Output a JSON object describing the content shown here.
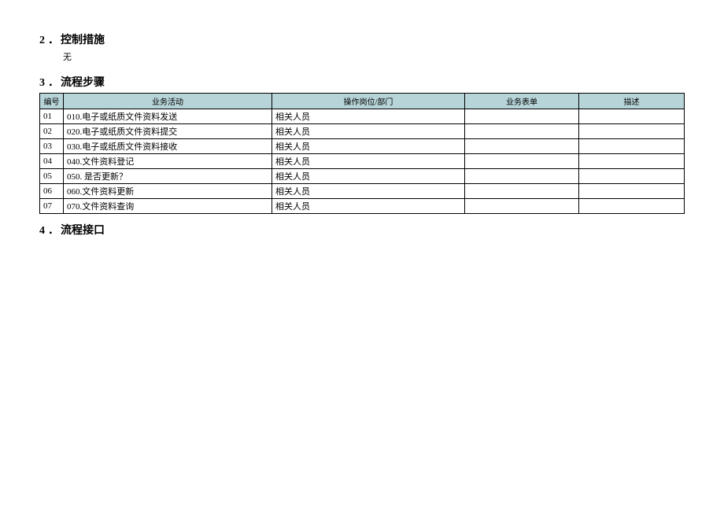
{
  "section2": {
    "number": "2",
    "dot": "．",
    "title": "控制措施",
    "content": "无"
  },
  "section3": {
    "number": "3",
    "dot": "．",
    "title": "流程步骤",
    "table": {
      "headers": {
        "id": "编号",
        "activity": "业务活动",
        "position": "操作岗位/部门",
        "form": "业务表单",
        "desc": "描述"
      },
      "rows": [
        {
          "id": "01",
          "activity": "010.电子或纸质文件资料发送",
          "position": "相关人员",
          "form": "",
          "desc": ""
        },
        {
          "id": "02",
          "activity": "020.电子或纸质文件资料提交",
          "position": "相关人员",
          "form": "",
          "desc": ""
        },
        {
          "id": "03",
          "activity": "030.电子或纸质文件资料接收",
          "position": "相关人员",
          "form": "",
          "desc": ""
        },
        {
          "id": "04",
          "activity": "040.文件资料登记",
          "position": "相关人员",
          "form": "",
          "desc": ""
        },
        {
          "id": "05",
          "activity": "050. 是否更新？",
          "position": "相关人员",
          "form": "",
          "desc": ""
        },
        {
          "id": "06",
          "activity": "060.文件资料更新",
          "position": "相关人员",
          "form": "",
          "desc": ""
        },
        {
          "id": "07",
          "activity": "070.文件资料查询",
          "position": "相关人员",
          "form": "",
          "desc": ""
        }
      ]
    }
  },
  "section4": {
    "number": "4",
    "dot": "．",
    "title": "流程接口"
  }
}
